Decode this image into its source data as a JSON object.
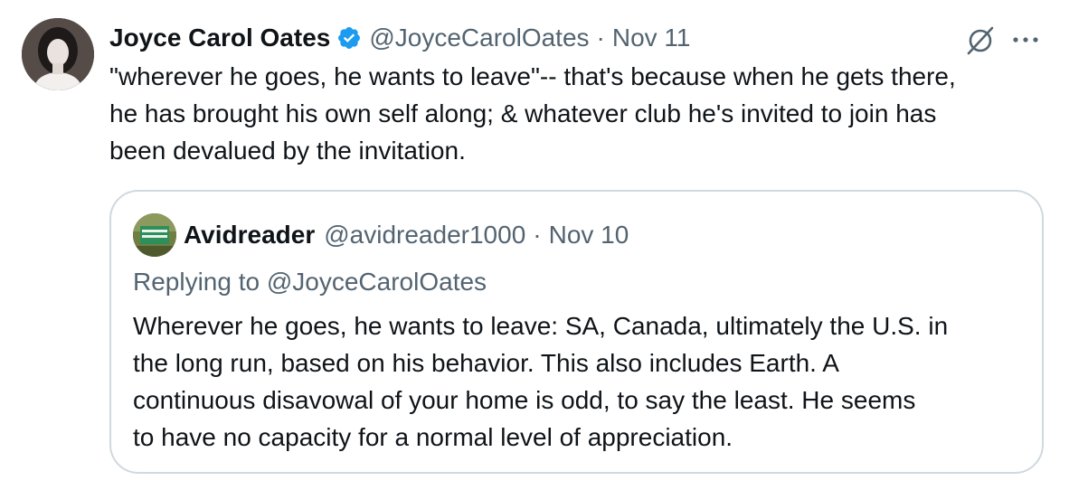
{
  "tweet": {
    "display_name": "Joyce Carol Oates",
    "verified_icon": "verified-badge-icon",
    "handle": "@JoyceCarolOates",
    "separator": "·",
    "time": "Nov 11",
    "text": "\"wherever he goes, he wants to leave\"-- that's because when he gets there,\nhe has brought his own self along; & whatever club he's invited to join has\nbeen devalued by the invitation.",
    "actions": {
      "grok_icon": "grok-icon",
      "more_icon": "more-options-icon"
    }
  },
  "quote": {
    "display_name": "Avidreader",
    "handle": "@avidreader1000",
    "separator": "·",
    "time": "Nov 10",
    "replying_to": "Replying to @JoyceCarolOates",
    "text": "Wherever he goes, he wants to leave: SA, Canada, ultimately the U.S. in\nthe long run, based on his behavior. This also includes Earth. A\ncontinuous disavowal of your home is odd, to say the least. He seems\nto have no capacity for a normal level of appreciation."
  },
  "colors": {
    "text_primary": "#0f1419",
    "text_secondary": "#536471",
    "border": "#cfd9de",
    "verified_blue": "#1d9bf0"
  }
}
